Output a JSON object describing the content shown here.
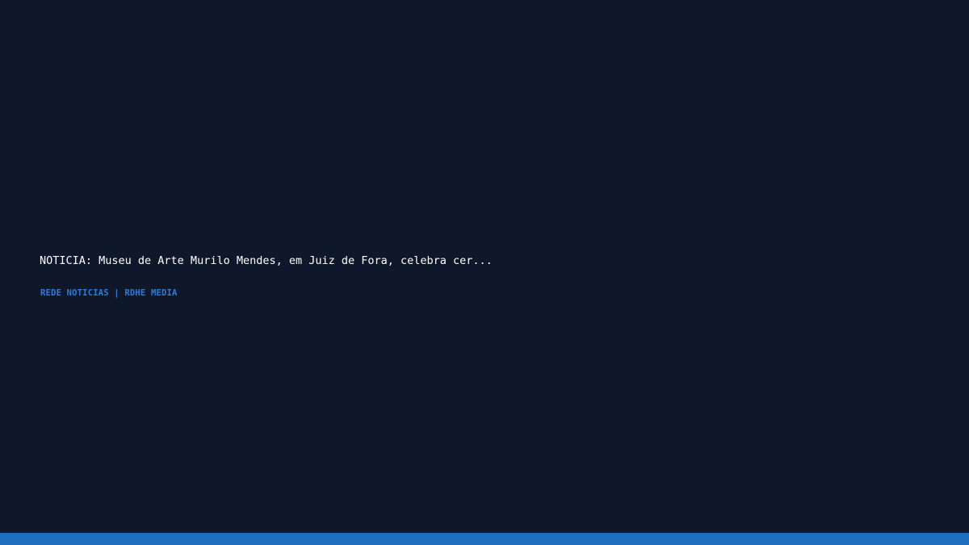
{
  "headline": {
    "text": "NOTICIA: Museu de Arte Murilo Mendes, em Juiz de Fora, celebra cer..."
  },
  "source": {
    "text": "REDE NOTICIAS | RDHE MEDIA"
  },
  "colors": {
    "background": "#0f172a",
    "headline_text": "#ffffff",
    "source_text": "#2f7bd8",
    "footer_bar": "#1f6ebd"
  }
}
